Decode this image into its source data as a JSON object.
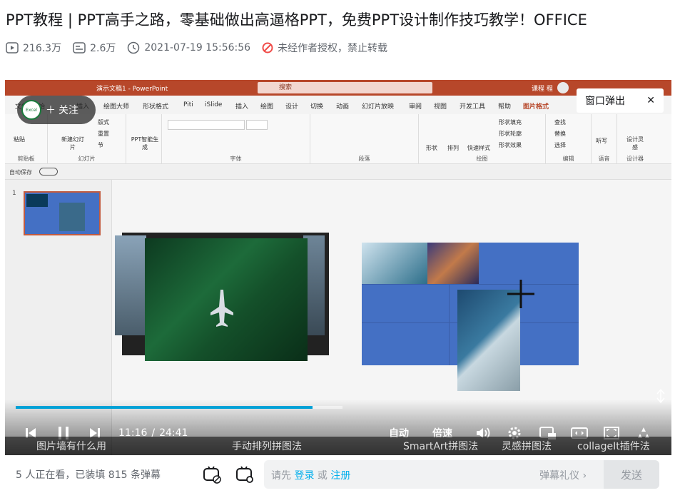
{
  "video": {
    "title": "PPT教程 | PPT高手之路，零基础做出高逼格PPT，免费PPT设计制作技巧教学！OFFICE",
    "views": "216.3万",
    "danmaku_count": "2.6万",
    "date": "2021-07-19 15:56:56",
    "copyright": "未经作者授权，禁止转载"
  },
  "ppt": {
    "doc_title": "演示文稿1 - PowerPoint",
    "search": "搜索",
    "user": "课程 程",
    "menu": [
      "文件",
      "开始",
      "插入",
      "绘图大师",
      "形状格式",
      "Piti",
      "iSlide",
      "插入",
      "绘图",
      "设计",
      "切换",
      "动画",
      "幻灯片放映",
      "审阅",
      "视图",
      "开发工具",
      "帮助",
      "图片格式"
    ],
    "groups": [
      "剪贴板",
      "幻灯片",
      "字体",
      "段落",
      "绘图",
      "编辑",
      "语音",
      "设计器"
    ],
    "ribbon_buttons": [
      "粘贴",
      "新建幻灯片",
      "版式",
      "重置",
      "节",
      "PPT智能生成",
      "形状",
      "排列",
      "快速样式",
      "形状填充",
      "形状轮廓",
      "形状效果",
      "查找",
      "替换",
      "选择",
      "听写",
      "设计灵感"
    ],
    "autosave": "自动保存",
    "slide_number": "1"
  },
  "overlay": {
    "follow": "关注",
    "avatar_text": "Excel",
    "popout": "窗口弹出"
  },
  "controls": {
    "current_time": "11:16",
    "total_time": "24:41",
    "time_sep": "/",
    "auto": "自动",
    "speed": "倍速",
    "progress": 0.456
  },
  "chapters": [
    "图片墙有什么用",
    "手动排列拼图法",
    "SmartArt拼图法",
    "灵感拼图法",
    "collageIt插件法"
  ],
  "danmaku": {
    "viewers": "5 人正在看，已装填 815 条弹幕",
    "hint_prefix": "请先",
    "login": "登录",
    "or": "或",
    "register": "注册",
    "gift": "弹幕礼仪",
    "send": "发送"
  }
}
